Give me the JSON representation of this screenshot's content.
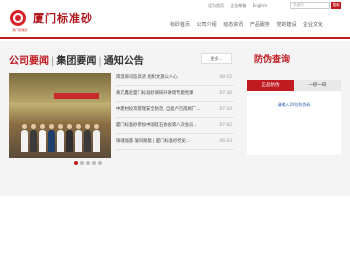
{
  "brand": {
    "name": "厦门标准砂",
    "sub": "厦门标准砂"
  },
  "toplinks": [
    "设为首页",
    "企业邮箱",
    "English"
  ],
  "search": {
    "placeholder": "关键词",
    "button": "搜索"
  },
  "nav": [
    "标砂首页",
    "公司介绍",
    "动态资讯",
    "产品服务",
    "党的建设",
    "企业文化"
  ],
  "tabs": [
    "公司要闻",
    "集团要闻",
    "通知公告"
  ],
  "more_label": "更多...",
  "news": [
    {
      "title": "南温郎司监高浓 组织文旅公人心",
      "date": "08-15"
    },
    {
      "title": "黄元鑫赴厦门标准砂调研开讲理专题党课",
      "date": "07-30"
    },
    {
      "title": "中建材投资管理安全防范, 自盈卢吉南顾厂...",
      "date": "07-10"
    },
    {
      "title": "厦门标准砂参加中国硅石协会第八次会员...",
      "date": "07-02"
    },
    {
      "title": "铸魂强基 凝风赋能 | 厦门标准砂党史...",
      "date": "06-23"
    }
  ],
  "anti_title": "防伪查询",
  "anti_tabs": [
    "正品防伪",
    "一砂一码"
  ],
  "anti_text": "请输入20位防伪码",
  "colors": {
    "accent": "#c01b21",
    "panel": "#f4f4f4"
  },
  "carousel": {
    "count": 5,
    "active": 1
  }
}
